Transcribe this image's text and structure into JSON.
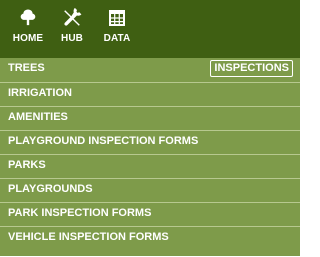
{
  "toolbar": {
    "items": [
      {
        "label": "HOME",
        "icon": "tree-icon"
      },
      {
        "label": "HUB",
        "icon": "tools-icon"
      },
      {
        "label": "DATA",
        "icon": "table-icon"
      }
    ]
  },
  "menu": {
    "items": [
      {
        "label": "TREES",
        "action_label": "INSPECTIONS"
      },
      {
        "label": "IRRIGATION"
      },
      {
        "label": "AMENITIES"
      },
      {
        "label": "PLAYGROUND INSPECTION FORMS"
      },
      {
        "label": "PARKS"
      },
      {
        "label": "PLAYGROUNDS"
      },
      {
        "label": "PARK INSPECTION FORMS"
      },
      {
        "label": "VEHICLE INSPECTION FORMS"
      }
    ]
  },
  "colors": {
    "toolbar_background": "#3f5f12",
    "menu_background": "#7e9b4a",
    "menu_divider": "#b7c88f",
    "text": "#ffffff"
  }
}
